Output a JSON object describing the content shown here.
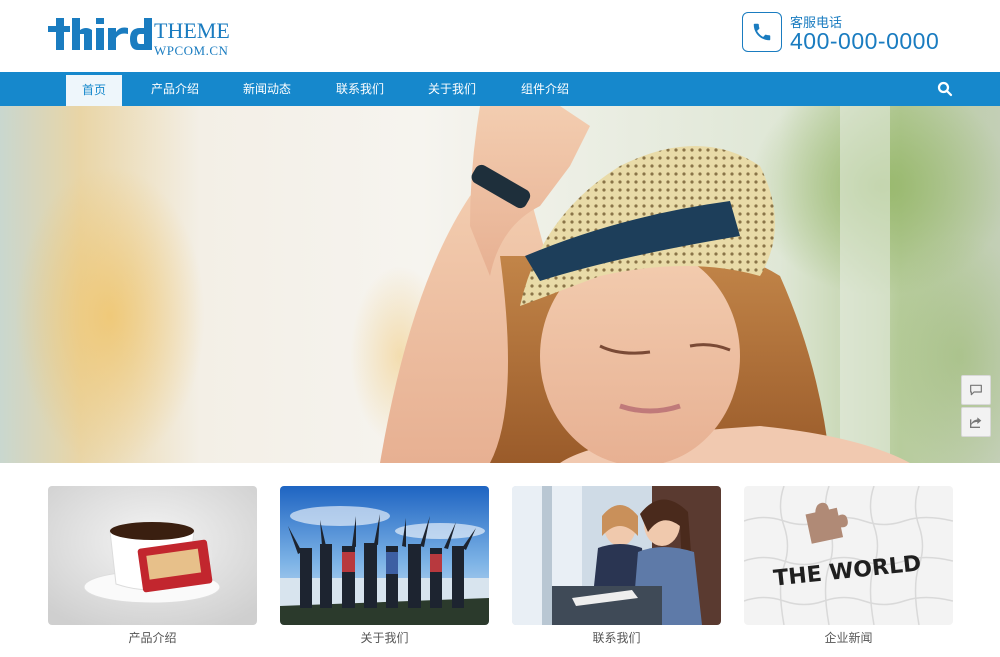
{
  "header": {
    "logo": {
      "mark_text": "Third",
      "line1": "THEME",
      "line2": "WPCOM.CN"
    },
    "phone": {
      "label": "客服电话",
      "number": "400-000-0000",
      "icon": "phone-icon"
    }
  },
  "nav": {
    "items": [
      {
        "label": "首页",
        "active": true
      },
      {
        "label": "产品介绍",
        "active": false
      },
      {
        "label": "新闻动态",
        "active": false
      },
      {
        "label": "联系我们",
        "active": false
      },
      {
        "label": "关于我们",
        "active": false
      },
      {
        "label": "组件介绍",
        "active": false
      }
    ],
    "search_icon": "search-icon"
  },
  "side_buttons": [
    {
      "icon": "comment-icon"
    },
    {
      "icon": "share-icon"
    }
  ],
  "tiles": [
    {
      "caption": "产品介绍",
      "image": "coffee-cup-with-biscuits"
    },
    {
      "caption": "关于我们",
      "image": "group-of-people-arms-raised"
    },
    {
      "caption": "联系我们",
      "image": "women-at-office-computer"
    },
    {
      "caption": "企业新闻",
      "image": "puzzle-the-world"
    }
  ],
  "tile_image_text": "THE WORLD",
  "colors": {
    "brand_blue": "#1688cc",
    "logo_blue": "#1a7cc0",
    "nav_active_bg": "#eef6fb"
  }
}
